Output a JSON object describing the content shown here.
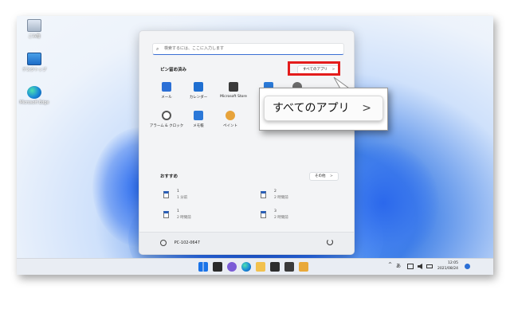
{
  "desktop": {
    "icons": [
      {
        "label": "ごみ箱"
      },
      {
        "label": "デスクトップ"
      },
      {
        "label": "Microsoft Edge"
      }
    ]
  },
  "start_menu": {
    "search_placeholder": "検索するには、ここに入力します",
    "pinned_title": "ピン留め済み",
    "all_apps_label": "すべてのアプリ",
    "all_apps_chevron": ">",
    "pinned_apps": [
      {
        "label": "メール",
        "icon": "mail-icon",
        "color": "#2b6fd6"
      },
      {
        "label": "カレンダー",
        "icon": "calendar-icon",
        "color": "#1f6fd1"
      },
      {
        "label": "Microsoft Store",
        "icon": "store-icon",
        "color": "#3a3a3a"
      },
      {
        "label": "アラーム & クロック",
        "icon": "clock-icon",
        "color": "#555555"
      },
      {
        "label": "メモ帳",
        "icon": "notepad-icon",
        "color": "#2b78d8"
      },
      {
        "label": "ペイント",
        "icon": "paint-icon",
        "color": "#e7a33b"
      }
    ],
    "recommended_title": "おすすめ",
    "more_label": "その他",
    "more_chevron": ">",
    "recommended": [
      {
        "name": "1",
        "time": "1 分前"
      },
      {
        "name": "2",
        "time": "2 時間前"
      },
      {
        "name": "1",
        "time": "2 時間前"
      },
      {
        "name": "3",
        "time": "2 時間前"
      }
    ],
    "user_name": "PC-102-0647"
  },
  "taskbar": {
    "time": "12:05",
    "date": "2021/08/24",
    "tray_glyphs": [
      "^",
      "あ"
    ]
  },
  "callout": {
    "label": "すべてのアプリ",
    "chevron": ">"
  },
  "colors": {
    "accent": "#3b6fd4",
    "highlight": "#e41c1c"
  }
}
